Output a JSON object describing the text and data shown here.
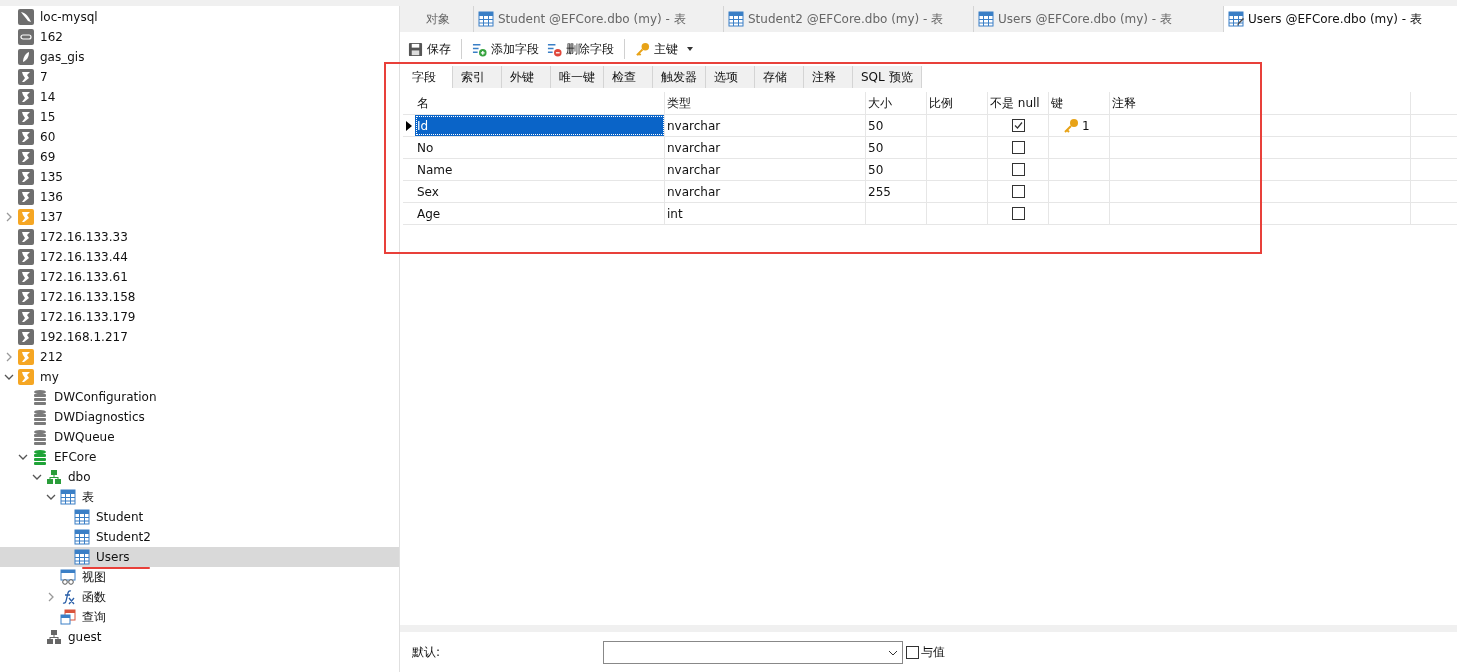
{
  "tree": [
    {
      "label": "loc-mysql",
      "kind": "mysql",
      "active": false
    },
    {
      "label": "162",
      "kind": "redis",
      "active": false
    },
    {
      "label": "gas_gis",
      "kind": "feather",
      "active": false
    },
    {
      "label": "7",
      "kind": "server",
      "active": false
    },
    {
      "label": "14",
      "kind": "server",
      "active": false
    },
    {
      "label": "15",
      "kind": "server",
      "active": false
    },
    {
      "label": "60",
      "kind": "server",
      "active": false
    },
    {
      "label": "69",
      "kind": "server",
      "active": false
    },
    {
      "label": "135",
      "kind": "server",
      "active": false
    },
    {
      "label": "136",
      "kind": "server",
      "active": false
    },
    {
      "label": "137",
      "kind": "server",
      "active": true,
      "expanded": false
    },
    {
      "label": "172.16.133.33",
      "kind": "server",
      "active": false
    },
    {
      "label": "172.16.133.44",
      "kind": "server",
      "active": false
    },
    {
      "label": "172.16.133.61",
      "kind": "server",
      "active": false
    },
    {
      "label": "172.16.133.158",
      "kind": "server",
      "active": false
    },
    {
      "label": "172.16.133.179",
      "kind": "server",
      "active": false
    },
    {
      "label": "192.168.1.217",
      "kind": "server",
      "active": false
    },
    {
      "label": "212",
      "kind": "server",
      "active": true,
      "expanded": false
    },
    {
      "label": "my",
      "kind": "server",
      "active": true,
      "expanded": true,
      "children": [
        {
          "label": "DWConfiguration",
          "kind": "database",
          "active": false
        },
        {
          "label": "DWDiagnostics",
          "kind": "database",
          "active": false
        },
        {
          "label": "DWQueue",
          "kind": "database",
          "active": false
        },
        {
          "label": "EFCore",
          "kind": "database",
          "active": true,
          "expanded": true,
          "children": [
            {
              "label": "dbo",
              "kind": "schema",
              "active": true,
              "expanded": true,
              "children": [
                {
                  "label": "表",
                  "kind": "table",
                  "expanded": true,
                  "children": [
                    {
                      "label": "Student",
                      "kind": "table",
                      "selected": false
                    },
                    {
                      "label": "Student2",
                      "kind": "table",
                      "selected": false
                    },
                    {
                      "label": "Users",
                      "kind": "table",
                      "selected": true
                    }
                  ]
                },
                {
                  "label": "视图",
                  "kind": "view"
                },
                {
                  "label": "函数",
                  "kind": "function",
                  "expanded": false
                },
                {
                  "label": "查询",
                  "kind": "query"
                }
              ]
            },
            {
              "label": "guest",
              "kind": "schema",
              "active": false
            }
          ]
        }
      ]
    }
  ],
  "tabs": [
    {
      "label": "对象",
      "kind": "plain",
      "selected": false
    },
    {
      "label": "Student @EFCore.dbo (my) - 表",
      "kind": "table",
      "selected": false
    },
    {
      "label": "Student2 @EFCore.dbo (my) - 表",
      "kind": "table",
      "selected": false
    },
    {
      "label": "Users @EFCore.dbo (my) - 表",
      "kind": "table",
      "selected": false
    },
    {
      "label": "Users @EFCore.dbo (my) - 表",
      "kind": "design",
      "selected": true
    }
  ],
  "toolbar": [
    {
      "label": "保存",
      "kind": "save"
    },
    {
      "label": "添加字段",
      "kind": "add"
    },
    {
      "label": "删除字段",
      "kind": "remove"
    },
    {
      "label": "主键",
      "kind": "key"
    }
  ],
  "subtabs": [
    {
      "label": "字段",
      "selected": true
    },
    {
      "label": "索引",
      "selected": false
    },
    {
      "label": "外键",
      "selected": false
    },
    {
      "label": "唯一键",
      "selected": false
    },
    {
      "label": "检查",
      "selected": false
    },
    {
      "label": "触发器",
      "selected": false
    },
    {
      "label": "选项",
      "selected": false
    },
    {
      "label": "存储",
      "selected": false
    },
    {
      "label": "注释",
      "selected": false
    },
    {
      "label": "SQL 预览",
      "selected": false
    }
  ],
  "grid": {
    "columns": [
      "名",
      "类型",
      "大小",
      "比例",
      "不是 null",
      "键",
      "注释"
    ],
    "rows": [
      {
        "name": "Id",
        "type": "nvarchar",
        "size": "50",
        "not_null": true,
        "key": "1",
        "selected": true
      },
      {
        "name": "No",
        "type": "nvarchar",
        "size": "50",
        "not_null": false,
        "selected": false
      },
      {
        "name": "Name",
        "type": "nvarchar",
        "size": "50",
        "not_null": false,
        "selected": false
      },
      {
        "name": "Sex",
        "type": "nvarchar",
        "size": "255",
        "not_null": false,
        "selected": false
      },
      {
        "name": "Age",
        "type": "int",
        "not_null": false,
        "selected": false
      }
    ]
  },
  "properties": {
    "default_label": "默认:",
    "with_value": {
      "label": "与值",
      "checked": false
    }
  }
}
